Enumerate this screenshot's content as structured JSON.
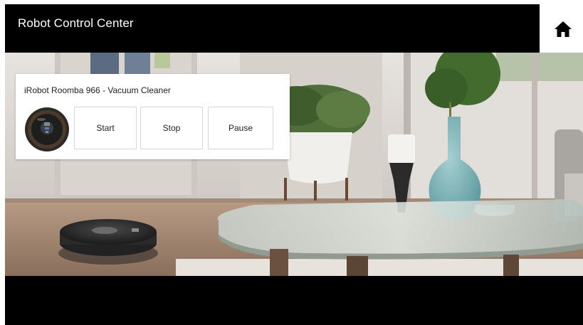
{
  "header": {
    "title": "Robot Control Center",
    "home_icon": "home-icon"
  },
  "device_card": {
    "title": "iRobot Roomba 966 - Vacuum Cleaner",
    "thumbnail_icon": "robot-vacuum-icon",
    "buttons": {
      "start": "Start",
      "stop": "Stop",
      "pause": "Pause"
    }
  },
  "background_scene": "living-room-with-robot-vacuum",
  "colors": {
    "header_bg": "#000000",
    "header_text": "#ffffff",
    "card_bg": "#ffffff",
    "button_border": "#d6d6d6"
  }
}
